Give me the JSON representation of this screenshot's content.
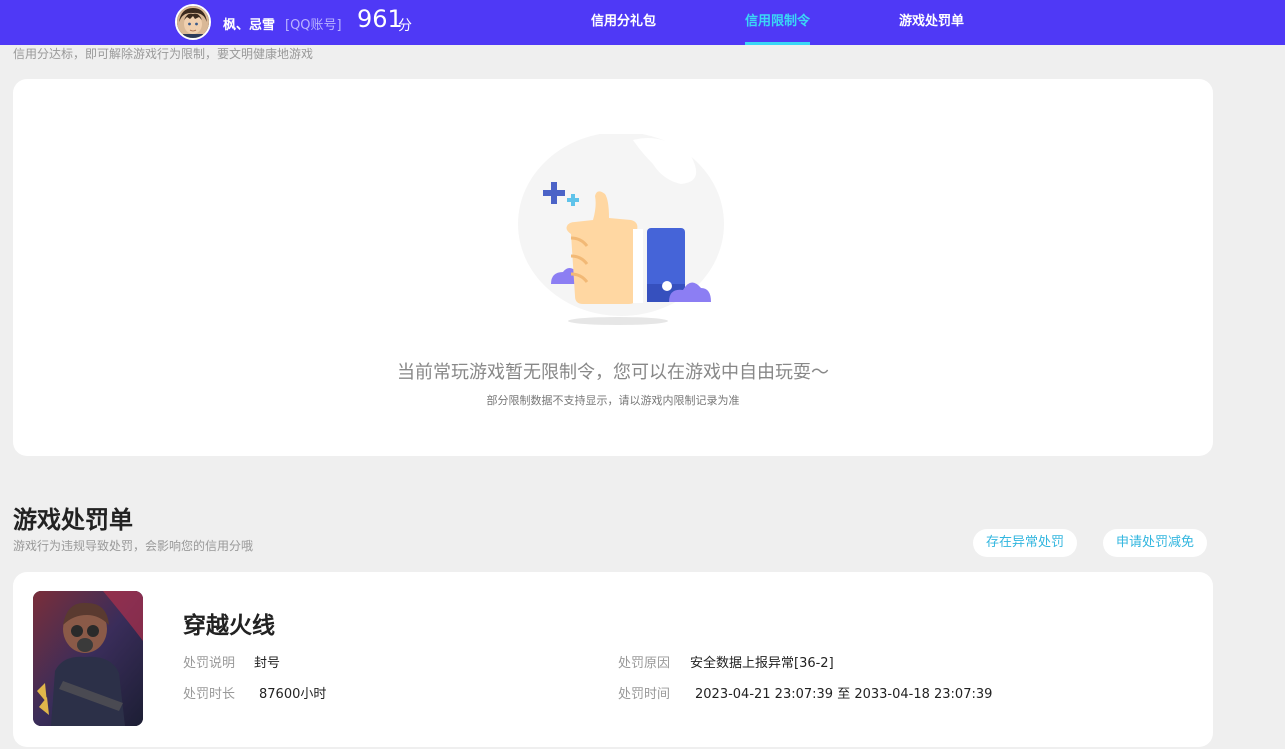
{
  "header": {
    "nickname": "枫、忌雪",
    "account_type": "[QQ账号]",
    "score": "961",
    "score_unit": "分",
    "tabs": [
      {
        "label": "信用分礼包",
        "active": false
      },
      {
        "label": "信用限制令",
        "active": true
      },
      {
        "label": "游戏处罚单",
        "active": false
      }
    ]
  },
  "restriction": {
    "description": "信用分达标，即可解除游戏行为限制，要文明健康地游戏",
    "empty_title": "当前常玩游戏暂无限制令，您可以在游戏中自由玩耍～",
    "empty_note": "部分限制数据不支持显示，请以游戏内限制记录为准"
  },
  "penalty_section": {
    "title": "游戏处罚单",
    "description": "游戏行为违规导致处罚，会影响您的信用分哦",
    "abnormal_button": "存在异常处罚",
    "appeal_button": "申请处罚减免"
  },
  "penalty": {
    "game_name": "穿越火线",
    "explain_label": "处罚说明",
    "explain_value": "封号",
    "duration_label": "处罚时长",
    "duration_value": "87600小时",
    "reason_label": "处罚原因",
    "reason_value": "安全数据上报异常[36-2]",
    "time_label": "处罚时间",
    "time_value": "2023-04-21 23:07:39 至 2033-04-18 23:07:39"
  },
  "colors": {
    "topbar": "#4f39f6",
    "active_tab": "#3ad7f5",
    "pill_text": "#32b6df",
    "background": "#efefef"
  }
}
